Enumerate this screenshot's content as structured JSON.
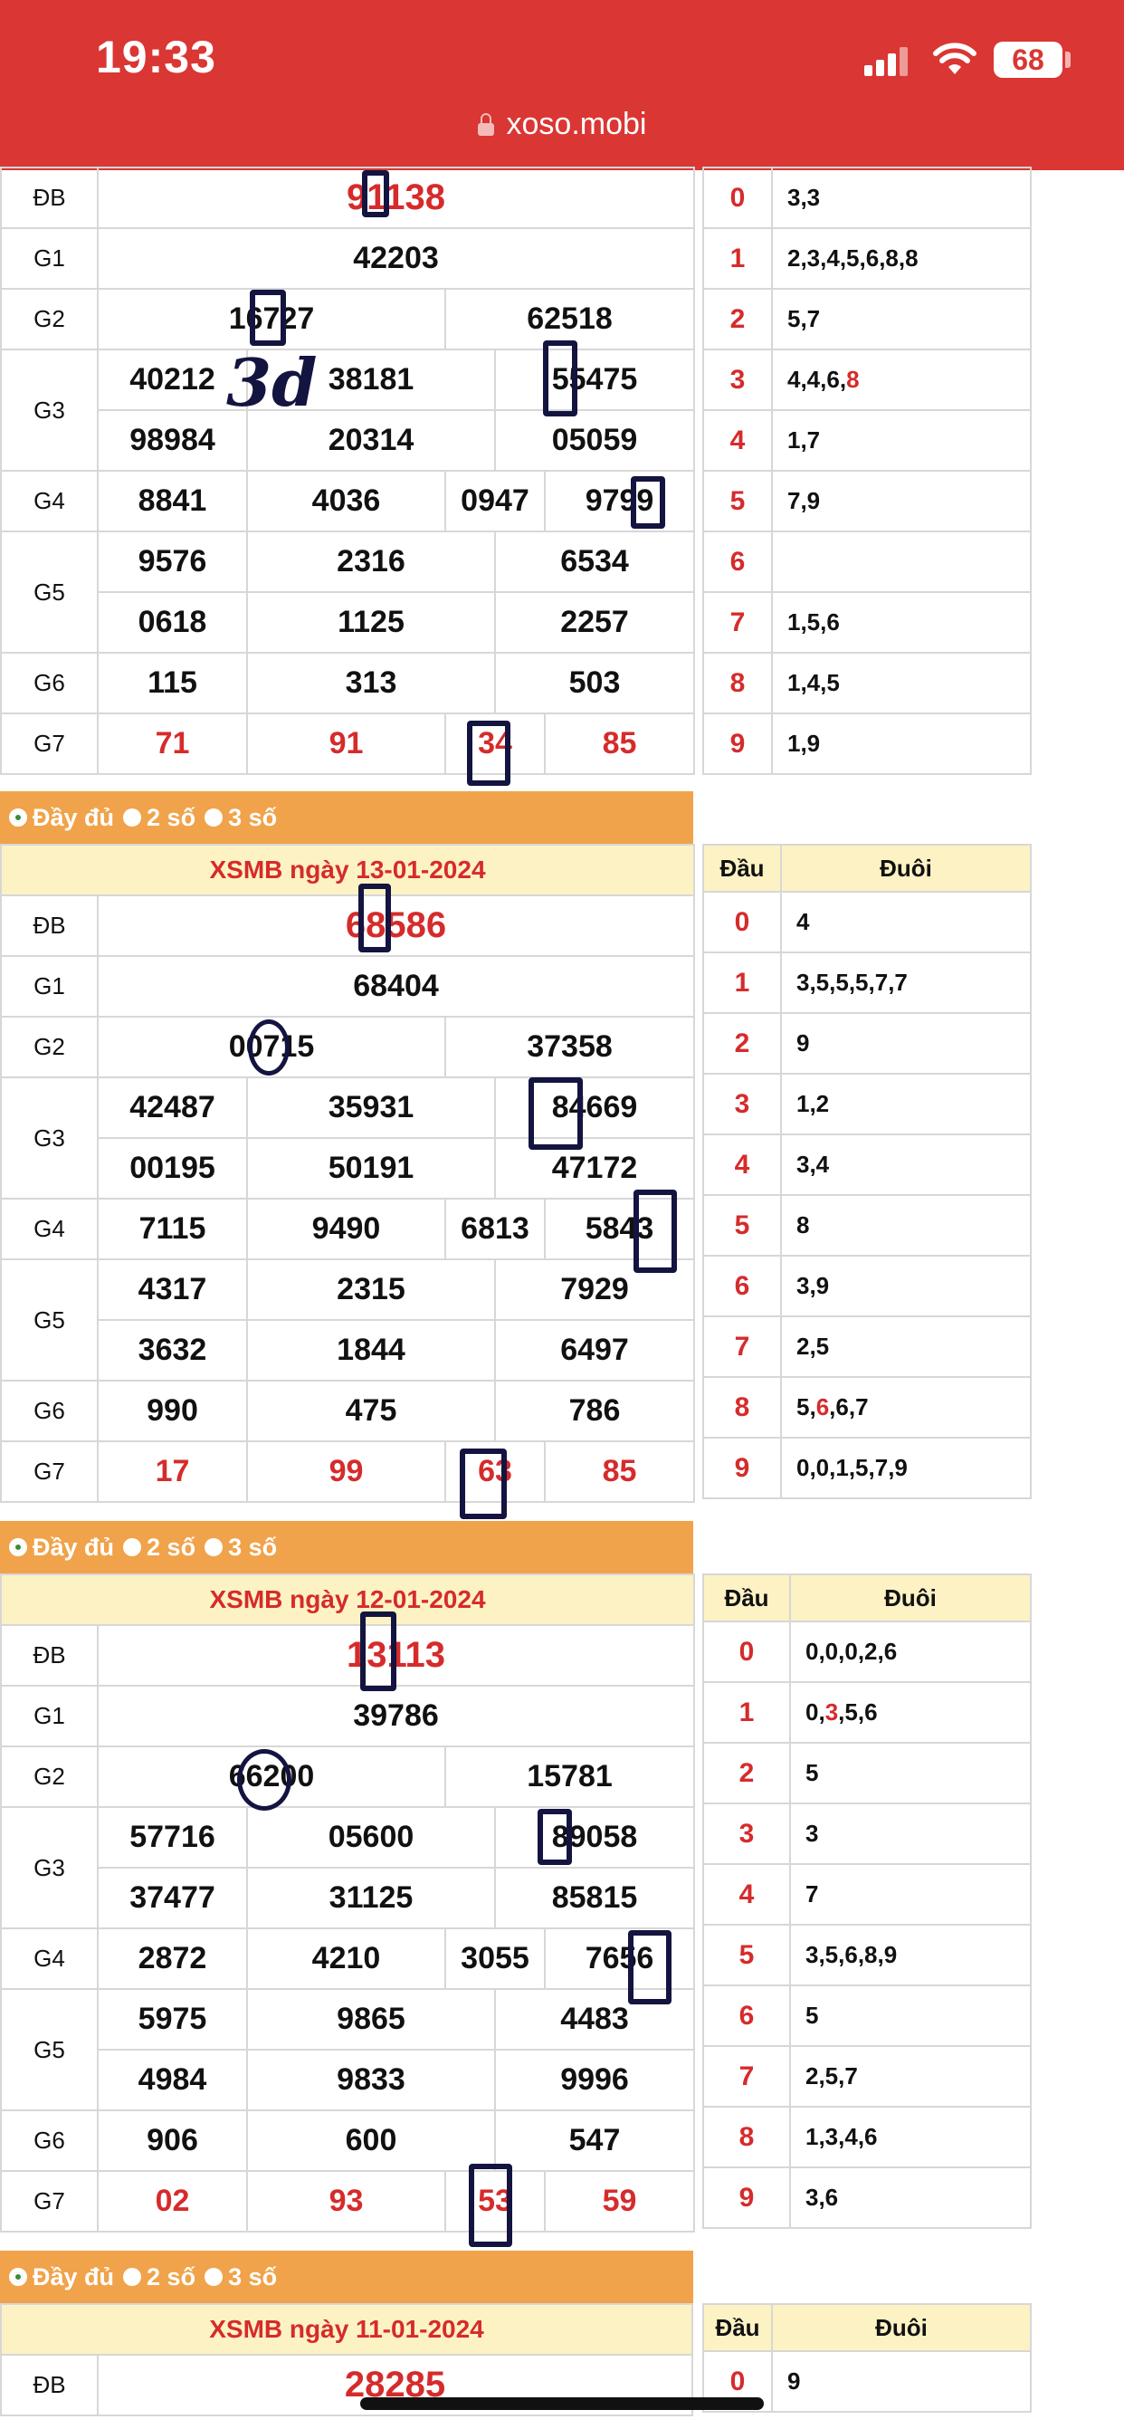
{
  "status": {
    "time": "19:33",
    "battery": "68",
    "url": "xoso.mobi"
  },
  "options": {
    "full": "Đầy đủ",
    "two": "2 số",
    "three": "3 số"
  },
  "dauHeader": "Đầu",
  "duoiHeader": "Đuôi",
  "labels": {
    "db": "ĐB",
    "g1": "G1",
    "g2": "G2",
    "g3": "G3",
    "g4": "G4",
    "g5": "G5",
    "g6": "G6",
    "g7": "G7"
  },
  "block1": {
    "db": "91138",
    "g1": "42203",
    "g2": [
      "16727",
      "62518"
    ],
    "g3": [
      "40212",
      "38181",
      "55475",
      "98984",
      "20314",
      "05059"
    ],
    "g4": [
      "8841",
      "4036",
      "0947",
      "9799"
    ],
    "g5": [
      "9576",
      "2316",
      "6534",
      "0618",
      "1125",
      "2257"
    ],
    "g6": [
      "115",
      "313",
      "503"
    ],
    "g7": [
      "71",
      "91",
      "34",
      "85"
    ],
    "tails": [
      "3,3",
      "2,3,4,5,6,8,8",
      "5,7",
      "4,4,6,",
      "1,7",
      "7,9",
      "",
      "1,5,6",
      "1,4,5",
      "1,9"
    ],
    "tail3red": "8"
  },
  "block2": {
    "title": "XSMB ngày 13-01-2024",
    "db": "68586",
    "g1": "68404",
    "g2": [
      "00715",
      "37358"
    ],
    "g3": [
      "42487",
      "35931",
      "84669",
      "00195",
      "50191",
      "47172"
    ],
    "g4": [
      "7115",
      "9490",
      "6813",
      "5843"
    ],
    "g5": [
      "4317",
      "2315",
      "7929",
      "3632",
      "1844",
      "6497"
    ],
    "g6": [
      "990",
      "475",
      "786"
    ],
    "g7": [
      "17",
      "99",
      "63",
      "85"
    ],
    "tails": [
      "4",
      "3,5,5,5,7,7",
      "9",
      "1,2",
      "3,4",
      "8",
      "3,9",
      "2,5",
      "",
      "0,0,1,5,7,9"
    ],
    "tail8": [
      "5,",
      "6",
      ",6,7"
    ]
  },
  "block3": {
    "title": "XSMB ngày 12-01-2024",
    "db": "13113",
    "g1": "39786",
    "g2": [
      "66200",
      "15781"
    ],
    "g3": [
      "57716",
      "05600",
      "89058",
      "37477",
      "31125",
      "85815"
    ],
    "g4": [
      "2872",
      "4210",
      "3055",
      "7656"
    ],
    "g5": [
      "5975",
      "9865",
      "4483",
      "4984",
      "9833",
      "9996"
    ],
    "g6": [
      "906",
      "600",
      "547"
    ],
    "g7": [
      "02",
      "93",
      "53",
      "59"
    ],
    "tails": [
      "0,0,0,2,6",
      "",
      "5",
      "3",
      "7",
      "3,5,6,8,9",
      "5",
      "2,5,7",
      "1,3,4,6",
      "3,6"
    ],
    "tail1": [
      "0,",
      "3",
      ",5,6"
    ]
  },
  "block4": {
    "title": "XSMB ngày 11-01-2024",
    "db": "28285",
    "tail0": "9"
  },
  "handwriting": "3d"
}
